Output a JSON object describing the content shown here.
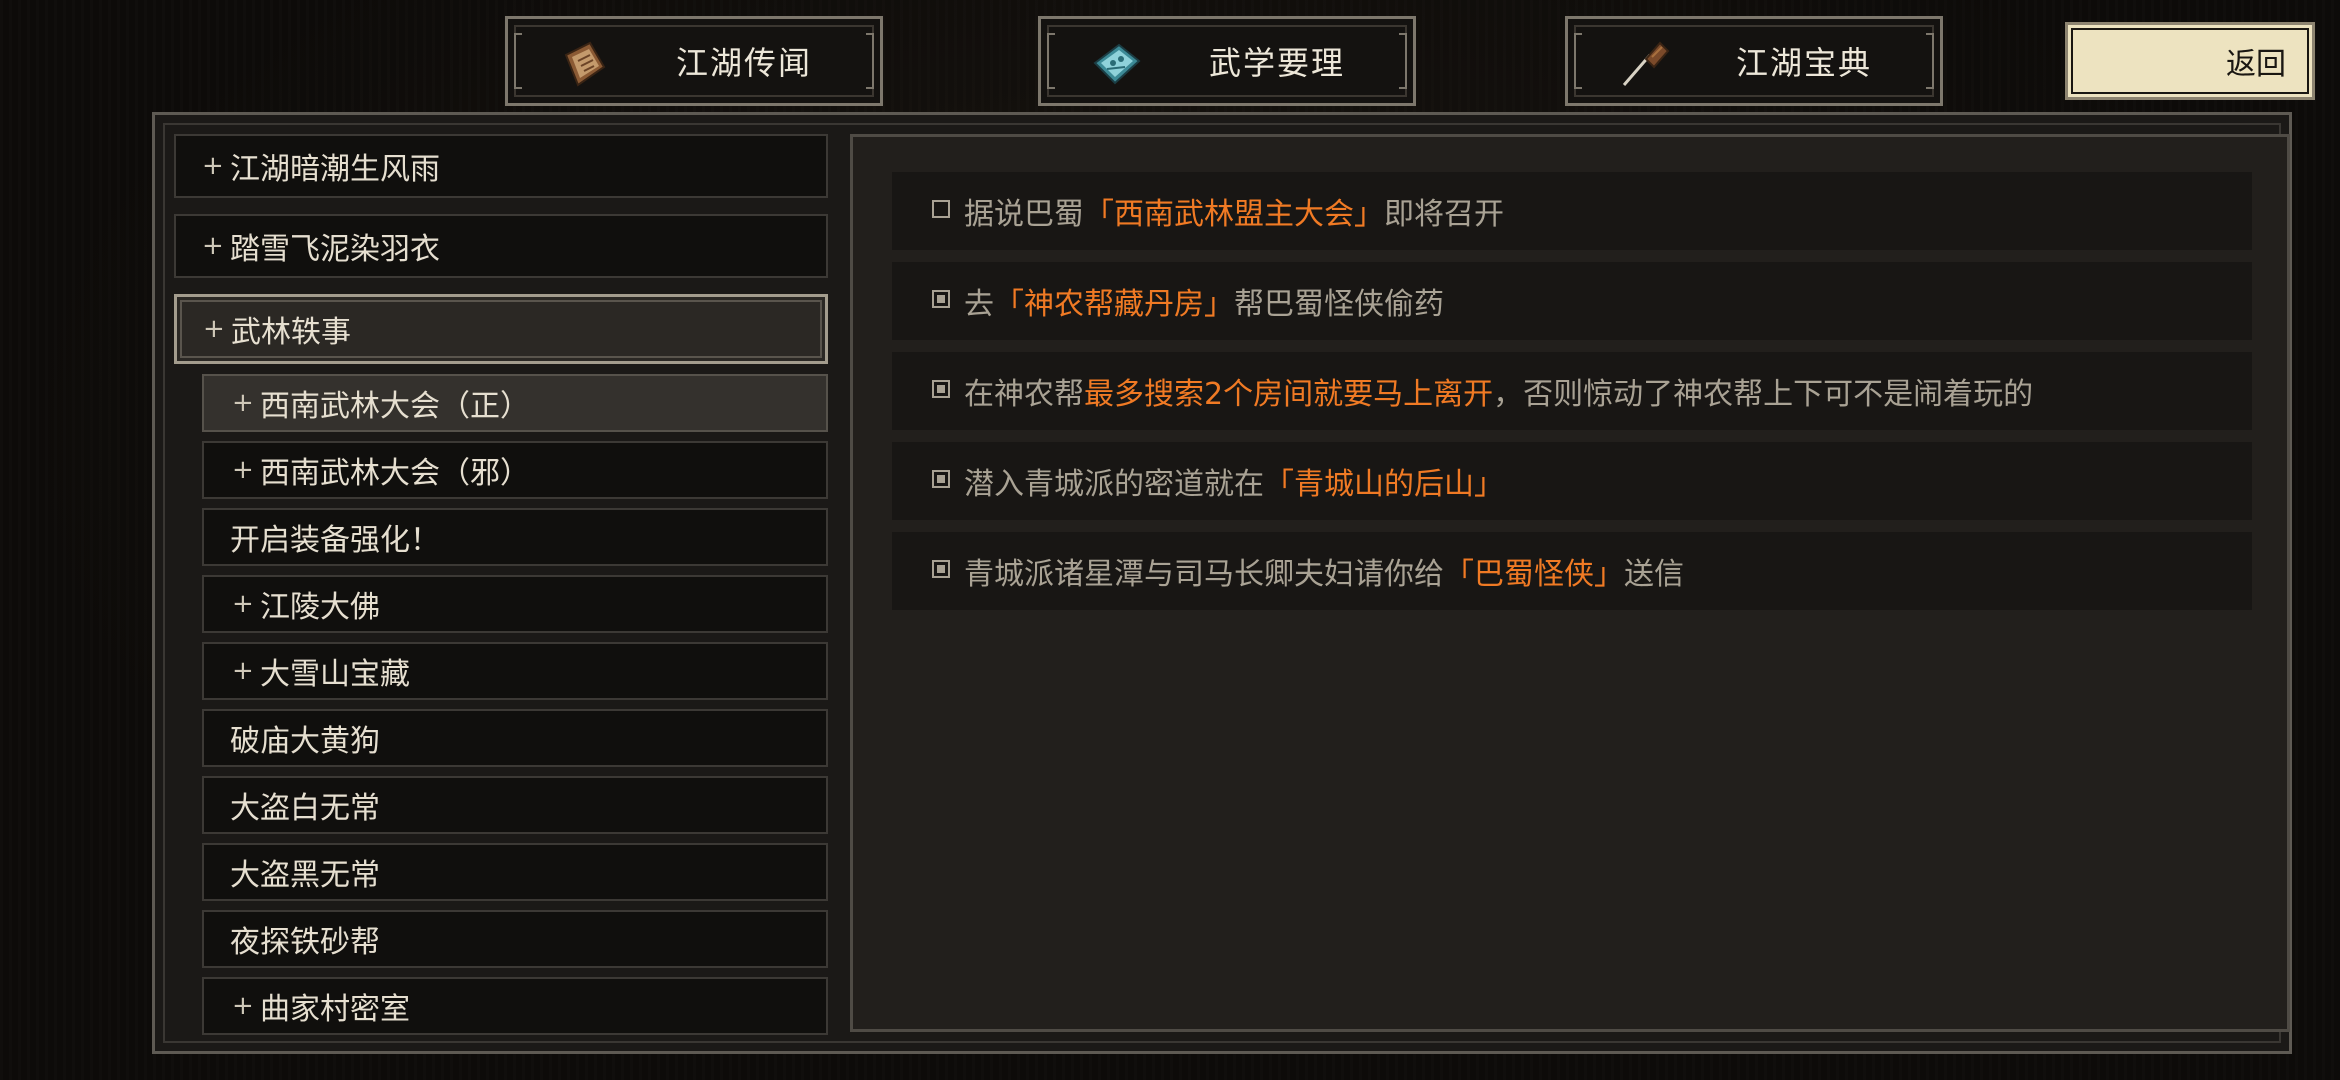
{
  "tabs": [
    {
      "label": "江湖传闻",
      "icon": "scroll-icon"
    },
    {
      "label": "武学要理",
      "icon": "manual-icon"
    },
    {
      "label": "江湖宝典",
      "icon": "brush-icon"
    }
  ],
  "back_label": "返回",
  "quest_list": [
    {
      "label": "江湖暗潮生风雨",
      "level": "top",
      "bullet": "+",
      "selected": false
    },
    {
      "label": "踏雪飞泥染羽衣",
      "level": "top",
      "bullet": "+",
      "selected": false
    },
    {
      "label": "武林轶事",
      "level": "top",
      "bullet": "+",
      "selected": true
    },
    {
      "label": "西南武林大会（正）",
      "level": "sub",
      "bullet": "+",
      "selected": true
    },
    {
      "label": "西南武林大会（邪）",
      "level": "sub",
      "bullet": "+",
      "selected": false
    },
    {
      "label": "开启装备强化！",
      "level": "sub",
      "bullet": "",
      "selected": false
    },
    {
      "label": "江陵大佛",
      "level": "sub",
      "bullet": "+",
      "selected": false
    },
    {
      "label": "大雪山宝藏",
      "level": "sub",
      "bullet": "+",
      "selected": false
    },
    {
      "label": "破庙大黄狗",
      "level": "sub",
      "bullet": "",
      "selected": false
    },
    {
      "label": "大盗白无常",
      "level": "sub",
      "bullet": "",
      "selected": false
    },
    {
      "label": "大盗黑无常",
      "level": "sub",
      "bullet": "",
      "selected": false
    },
    {
      "label": "夜探铁砂帮",
      "level": "sub",
      "bullet": "",
      "selected": false
    },
    {
      "label": "曲家村密室",
      "level": "sub",
      "bullet": "+",
      "selected": false
    }
  ],
  "tasks": [
    {
      "checked": false,
      "parts": [
        {
          "text": "据说巴蜀",
          "hl": false
        },
        {
          "text": "「西南武林盟主大会」",
          "hl": true
        },
        {
          "text": "即将召开",
          "hl": false
        }
      ]
    },
    {
      "checked": true,
      "parts": [
        {
          "text": "去",
          "hl": false
        },
        {
          "text": "「神农帮藏丹房」",
          "hl": true
        },
        {
          "text": "帮巴蜀怪侠偷药",
          "hl": false
        }
      ]
    },
    {
      "checked": true,
      "parts": [
        {
          "text": "在神农帮",
          "hl": false
        },
        {
          "text": "最多搜索2个房间就要马上离开",
          "hl": true
        },
        {
          "text": "，否则惊动了神农帮上下可不是闹着玩的",
          "hl": false
        }
      ]
    },
    {
      "checked": true,
      "parts": [
        {
          "text": "潜入青城派的密道就在",
          "hl": false
        },
        {
          "text": "「青城山的后山」",
          "hl": true
        }
      ]
    },
    {
      "checked": true,
      "parts": [
        {
          "text": "青城派诸星潭与司马长卿夫妇请你给",
          "hl": false
        },
        {
          "text": "「巴蜀怪侠」",
          "hl": true
        },
        {
          "text": "送信",
          "hl": false
        }
      ]
    }
  ],
  "colors": {
    "highlight": "#f07a24",
    "text": "#a9a294",
    "back_button_bg": "#ede3c0"
  }
}
